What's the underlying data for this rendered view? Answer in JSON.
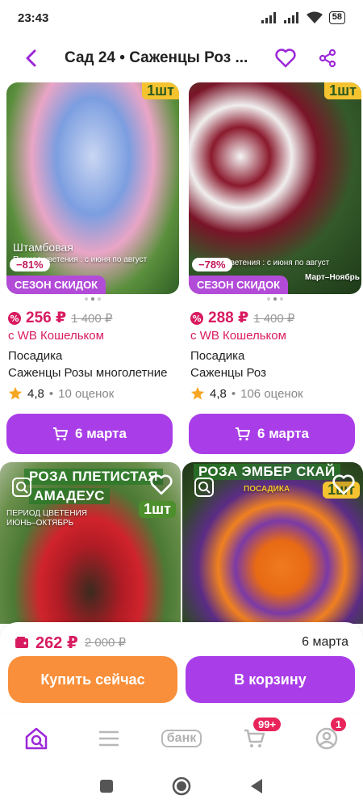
{
  "status_bar": {
    "time": "23:43",
    "battery": "58"
  },
  "header": {
    "title": "Сад 24 • Саженцы Роз ..."
  },
  "products": [
    {
      "qty_badge": "1шт",
      "image_text_1": "Штамбовая",
      "image_text_2": "Период цветения : с июня по август",
      "discount": "−81%",
      "sale_label": "СЕЗОН СКИДОК",
      "price": "256 ₽",
      "old_price": "1 400 ₽",
      "wallet": "с WB Кошельком",
      "brand": "Посадика",
      "name": "Саженцы Розы многолетние",
      "rating": "4,8",
      "reviews": "10 оценок",
      "delivery": "6 марта"
    },
    {
      "qty_badge": "1шт",
      "image_text_1": "Период цветения : с июня по август",
      "image_text_2": "Март–Ноябрь",
      "discount": "−78%",
      "sale_label": "СЕЗОН СКИДОК",
      "price": "288 ₽",
      "old_price": "1 400 ₽",
      "wallet": "с WB Кошельком",
      "brand": "Посадика",
      "name": "Саженцы Роз",
      "rating": "4,8",
      "reviews": "106 оценок",
      "delivery": "6 марта"
    },
    {
      "image_title_1": "РОЗА ПЛЕТИСТАЯ",
      "image_title_2": "АМАДЕУС",
      "image_text_1": "ПЕРИОД ЦВЕТЕНИЯ",
      "image_text_2": "ИЮНЬ–ОКТЯБРЬ",
      "qty_badge": "1шт"
    },
    {
      "image_title_1": "РОЗА ЭМБЕР СКАЙ",
      "image_text_1": "ПОСАДИКА",
      "qty_badge": "1шт"
    }
  ],
  "sheet": {
    "price": "262 ₽",
    "old_price": "2 000 ₽",
    "delivery": "6 марта",
    "buy_now_label": "Купить сейчас",
    "to_cart_label": "В корзину"
  },
  "bottom_nav": {
    "bank_label": "банк",
    "cart_badge": "99+",
    "profile_badge": "1"
  },
  "colors": {
    "accent": "#a93ee8",
    "price": "#d81b60",
    "buy_now": "#f98f3a"
  }
}
